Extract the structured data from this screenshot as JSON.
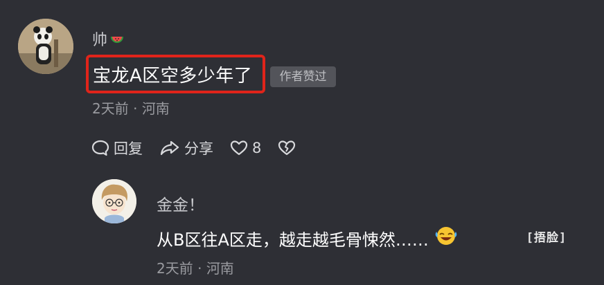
{
  "comment": {
    "username": "帅",
    "text": "宝龙A区空多少年了",
    "badge": "作者赞过",
    "time": "2天前",
    "separator": "·",
    "location": "河南",
    "actions": {
      "reply_label": "回复",
      "share_label": "分享",
      "like_count": "8"
    }
  },
  "reply": {
    "username": "金金！",
    "text": "从B区往A区走，越走越毛骨悚然……",
    "sticker_text": "[捂脸]",
    "time": "2天前",
    "separator": "·",
    "location": "河南"
  },
  "colors": {
    "background": "#2e2f35",
    "highlight": "#e0241a",
    "badge_bg": "#53545a"
  }
}
